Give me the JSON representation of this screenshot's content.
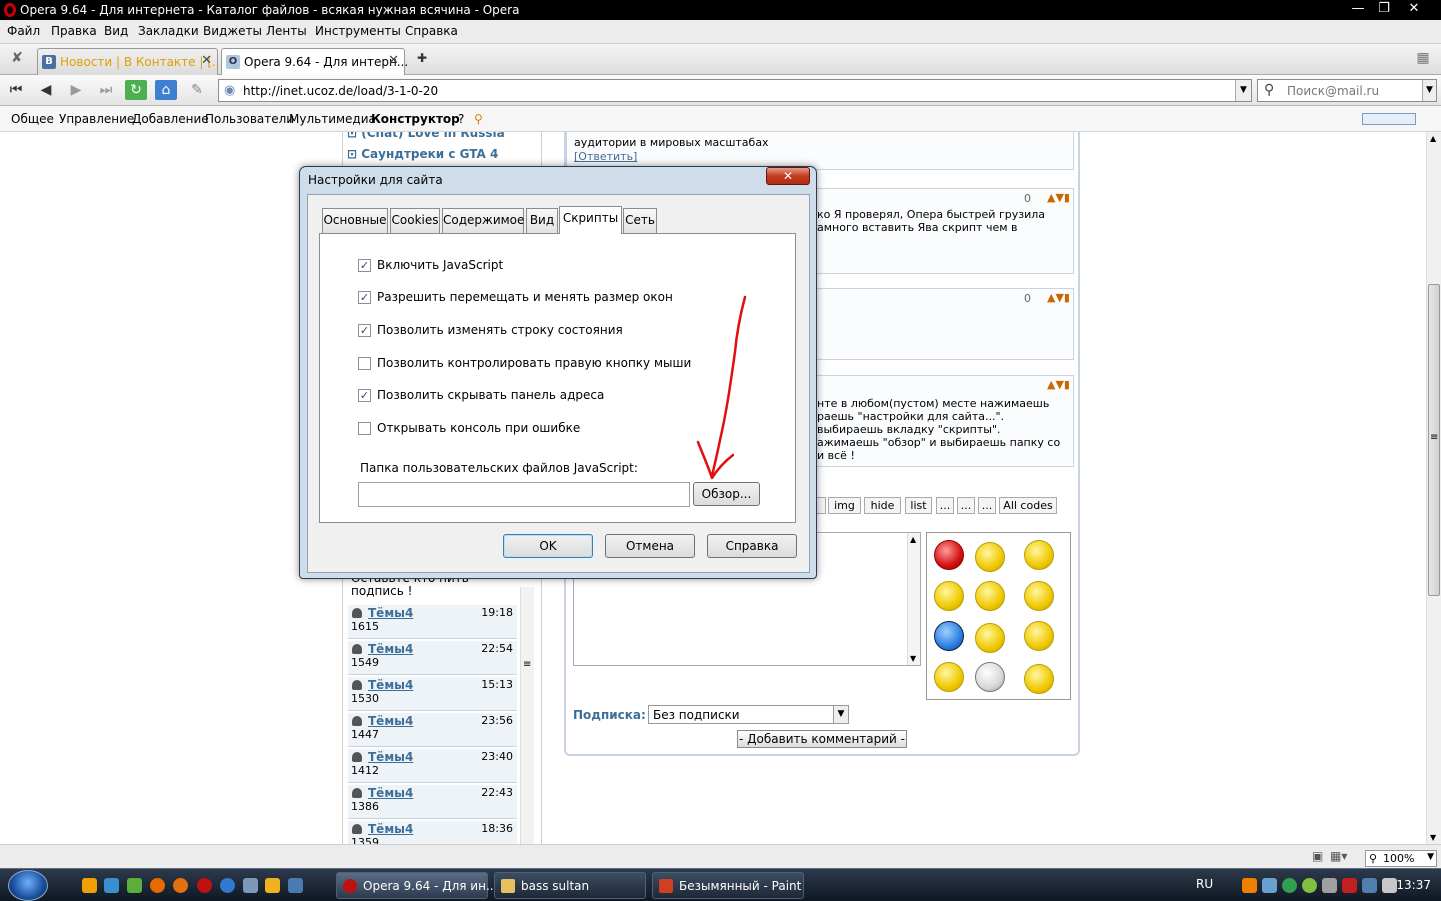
{
  "window": {
    "title": "Opera 9.64 - Для интернета - Каталог файлов - всякая нужная всячина - Opera"
  },
  "menu": [
    "Файл",
    "Правка",
    "Вид",
    "Закладки",
    "Виджеты",
    "Ленты",
    "Инструменты",
    "Справка"
  ],
  "tabs": [
    {
      "label": "Новости | В Контакте | [...",
      "icon": "vk-icon",
      "active": false
    },
    {
      "label": "Opera 9.64 - Для интерн...",
      "icon": "opera-icon",
      "active": true
    }
  ],
  "address": {
    "url": "http://inet.ucoz.de/load/3-1-0-20"
  },
  "search": {
    "placeholder": "Поиск@mail.ru"
  },
  "ucoz_bar": [
    "Общее",
    "Управление",
    "Добавление",
    "Пользователи",
    "Мультимедиа",
    "Конструктор",
    "?"
  ],
  "left_column": {
    "top_items": [
      "(Chat) Love in Russia",
      "Саундтреки с GTA 4"
    ],
    "partial_text": [
      "Оставьте кто нить",
      "подпись !"
    ],
    "forum_rows": [
      {
        "name": "Тёмы4",
        "time": "19:18",
        "count": "1615"
      },
      {
        "name": "Тёмы4",
        "time": "22:54",
        "count": "1549"
      },
      {
        "name": "Тёмы4",
        "time": "15:13",
        "count": "1530"
      },
      {
        "name": "Тёмы4",
        "time": "23:56",
        "count": "1447"
      },
      {
        "name": "Тёмы4",
        "time": "23:40",
        "count": "1412"
      },
      {
        "name": "Тёмы4",
        "time": "22:43",
        "count": "1386"
      },
      {
        "name": "Тёмы4",
        "time": "18:36",
        "count": "1359"
      }
    ]
  },
  "comments": {
    "c1": {
      "line1": "аудитории в мировых масштабах",
      "reply": "[Ответить]"
    },
    "c2": {
      "score": "0",
      "line1": "ко Я проверял, Опера быстрей грузила",
      "line2": "амного вставить Ява скрипт чем в"
    },
    "c3": {
      "score": "0"
    },
    "c4": {
      "line1": "нте в любом(пустом) месте нажимаешь",
      "line2": "раешь \"настройки для сайта...\".",
      "line3": "выбираешь вкладку \"скрипты\".",
      "line4": "ажимаешь \"обзор\" и выбираешь папку со",
      "line5": "и всё !"
    }
  },
  "code_buttons": [
    "img",
    "hide",
    "list",
    "...",
    "...",
    "...",
    "All codes"
  ],
  "subscription": {
    "label": "Подписка:",
    "value": "Без подписки"
  },
  "add_comment": "- Добавить комментарий -",
  "dialog": {
    "title": "Настройки для сайта",
    "close": "✕",
    "tabs": [
      "Основные",
      "Cookies",
      "Содержимое",
      "Вид",
      "Скрипты",
      "Сеть"
    ],
    "active_tab": "Скрипты",
    "options": [
      {
        "label": "Включить JavaScript",
        "checked": true
      },
      {
        "label": "Разрешить перемещать и менять размер окон",
        "checked": true
      },
      {
        "label": "Позволить изменять строку состояния",
        "checked": true
      },
      {
        "label": "Позволить контролировать правую кнопку мыши",
        "checked": false
      },
      {
        "label": "Позволить скрывать панель адреса",
        "checked": true
      },
      {
        "label": "Открывать консоль при ошибке",
        "checked": false
      }
    ],
    "folder_label": "Папка пользовательских файлов JavaScript:",
    "folder_value": "",
    "browse": "Обзор...",
    "ok": "OK",
    "cancel": "Отмена",
    "help": "Справка"
  },
  "status": {
    "zoom": "100%"
  },
  "taskbar": {
    "tasks": [
      {
        "label": "Opera 9.64 - Для ин...",
        "active": true
      },
      {
        "label": "bass sultan",
        "active": false
      },
      {
        "label": "Безымянный - Paint",
        "active": false
      }
    ],
    "lang": "RU",
    "clock": "13:37"
  },
  "colors": {
    "accent": "#3d6f99",
    "annotation": "#e01010"
  }
}
